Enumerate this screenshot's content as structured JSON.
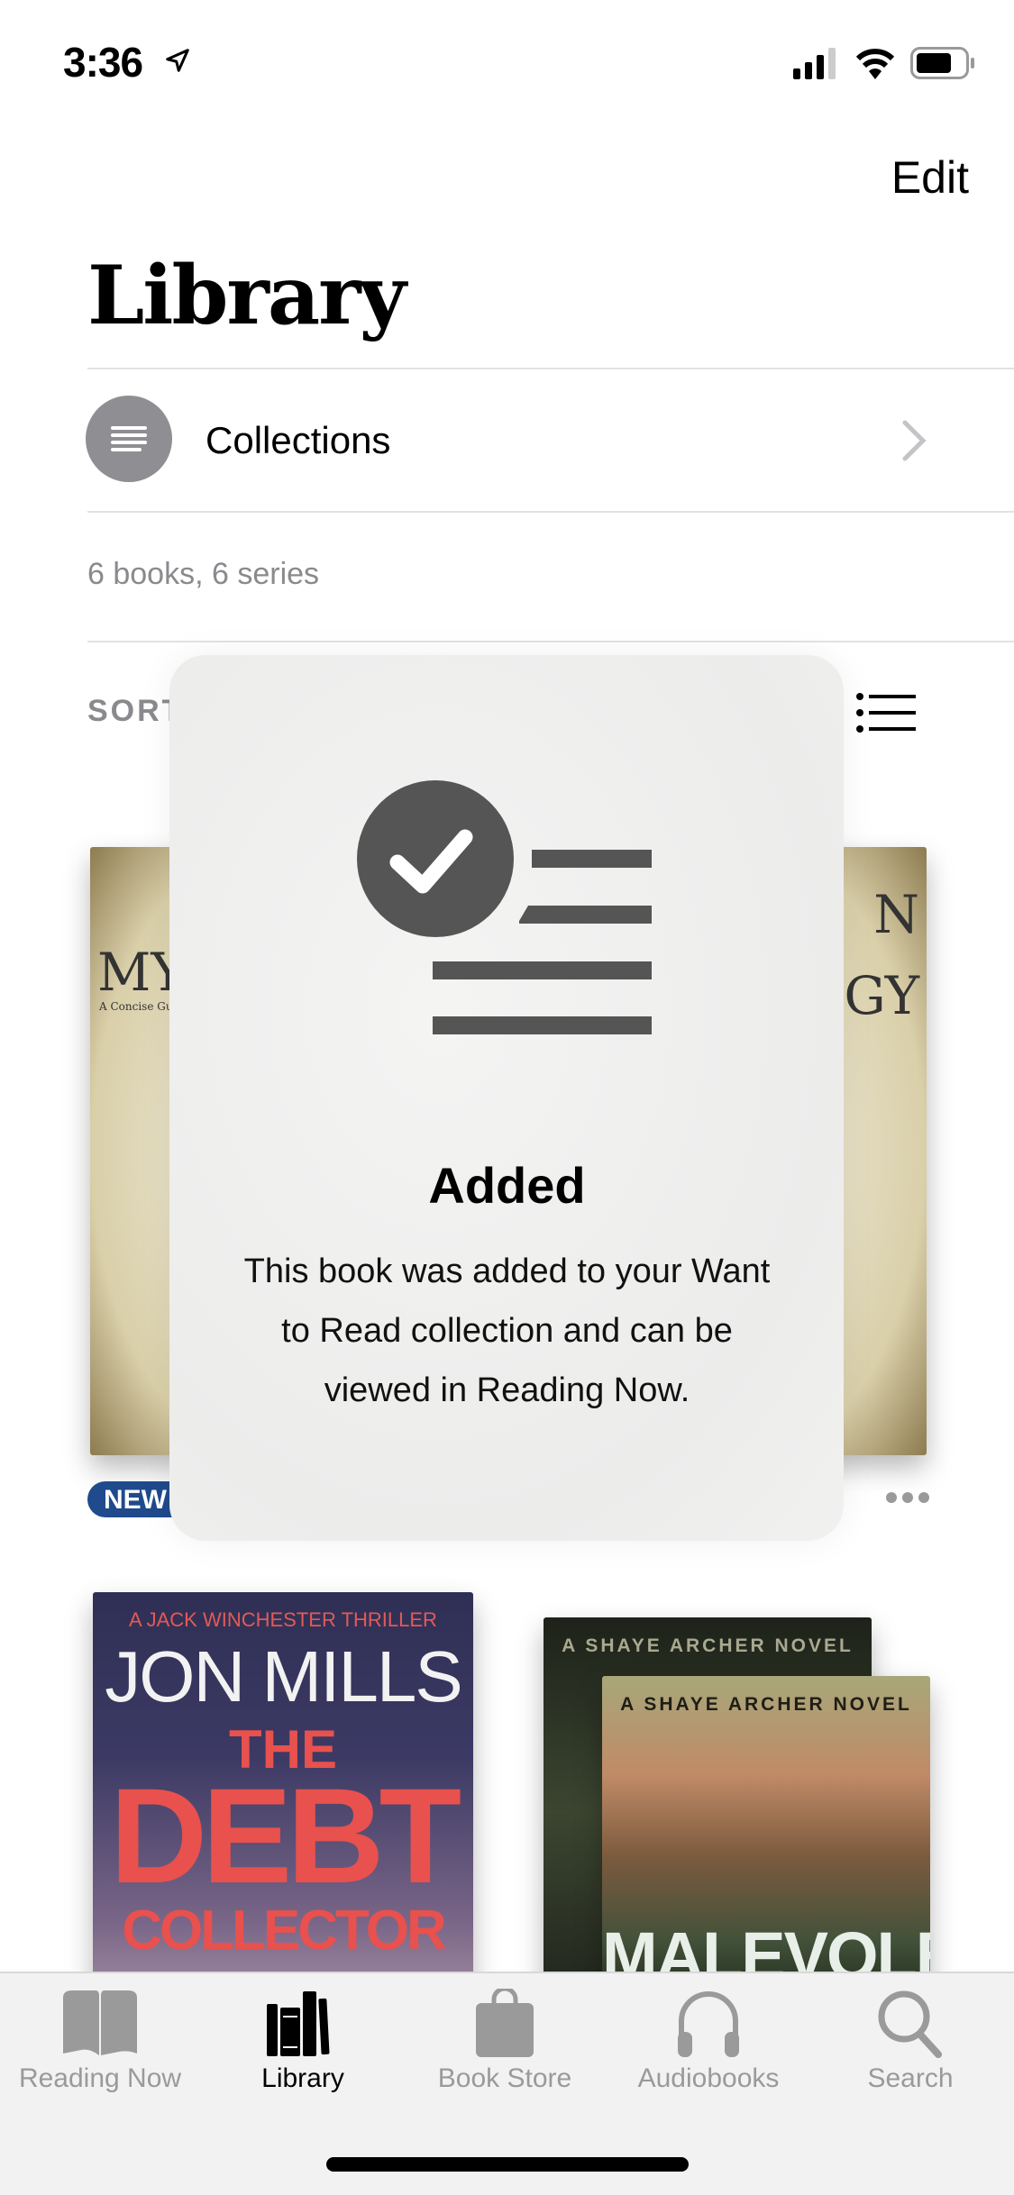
{
  "status_bar": {
    "time": "3:36",
    "icons": [
      "location-arrow-icon",
      "signal-icon",
      "wifi-icon",
      "battery-icon"
    ]
  },
  "header": {
    "edit_label": "Edit",
    "title": "Library"
  },
  "collections": {
    "label": "Collections",
    "icon": "collections-icon"
  },
  "summary": "6 books, 6 series",
  "sort_label": "SORT",
  "books": [
    {
      "cover_title": "MY",
      "cover_subtitle": "A Concise Gui",
      "badge": "NEW"
    },
    {
      "cover_title": "N GY"
    },
    {
      "series": "A JACK WINCHESTER THRILLER",
      "author": "JON MILLS",
      "title_line1": "THE",
      "title_line2": "DEBT",
      "title_line3": "COLLECTOR"
    },
    {
      "series": "A SHAYE ARCHER NOVEL",
      "back_series": "A SHAYE ARCHER NOVEL",
      "title": "MALEVOLENT"
    }
  ],
  "toast": {
    "title": "Added",
    "message": "This book was added to your Want to Read collection and can be viewed in Reading Now.",
    "icon": "checklist-added-icon"
  },
  "tabs": [
    {
      "label": "Reading Now",
      "icon": "open-book-icon",
      "active": false
    },
    {
      "label": "Library",
      "icon": "books-icon",
      "active": true
    },
    {
      "label": "Book Store",
      "icon": "shopping-bag-icon",
      "active": false
    },
    {
      "label": "Audiobooks",
      "icon": "headphones-icon",
      "active": false
    },
    {
      "label": "Search",
      "icon": "search-icon",
      "active": false
    }
  ],
  "colors": {
    "badge": "#1f4a8c",
    "icon_gray": "#9a9a9a",
    "toast_icon": "#555555"
  }
}
